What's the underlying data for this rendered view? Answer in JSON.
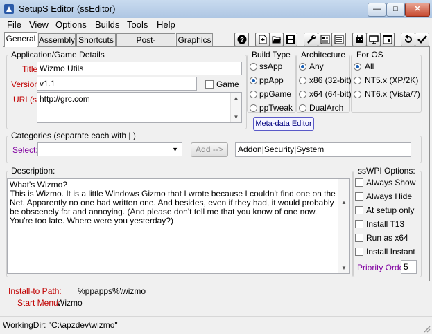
{
  "window": {
    "title": "SetupS Editor (ssEditor)",
    "minimize": "—",
    "maximize": "□",
    "close": "✕"
  },
  "menu": [
    "File",
    "View",
    "Options",
    "Builds",
    "Tools",
    "Help"
  ],
  "tabs": [
    "General",
    "Assembly",
    "Shortcuts",
    "Post-processing",
    "Graphics"
  ],
  "toolbar": [
    "help-icon",
    "new-file-icon",
    "open-folder-icon",
    "save-icon",
    "tools-wrench-icon",
    "properties-icon",
    "list-icon",
    "build-icon",
    "monitor-icon",
    "window-icon",
    "undo-icon",
    "apply-check-icon"
  ],
  "app_details": {
    "legend": "Application/Game Details",
    "title_label": "Title",
    "title_value": "Wizmo Utils",
    "version_label": "Version",
    "version_value": "v1.1",
    "game_label": "Game",
    "urls_label": "URL(s)",
    "urls_value": "http://grc.com"
  },
  "build_type": {
    "legend": "Build Type",
    "options": [
      "ssApp",
      "ppApp",
      "ppGame",
      "ppTweak"
    ],
    "selected": 1
  },
  "architecture": {
    "legend": "Architecture",
    "options": [
      "Any",
      "x86 (32-bit)",
      "x64 (64-bit)",
      "DualArch"
    ],
    "selected": 0
  },
  "for_os": {
    "legend": "For OS",
    "options": [
      "All",
      "NT5.x (XP/2K)",
      "NT6.x (Vista/7)"
    ],
    "selected": 0
  },
  "metadata_button": "Meta-data Editor",
  "categories": {
    "legend": "Categories (separate each with | )",
    "select_label": "Select:",
    "select_value": "",
    "add_button": "Add -->",
    "value": "Addon|Security|System"
  },
  "description": {
    "legend": "Description:",
    "text": "What's Wizmo?\nThis is Wizmo. It is a little Windows Gizmo that I wrote because I couldn't find one on the Net. Apparently no one had written one. And besides, even if they had, it would probably be obscenely fat and annoying. (And please don't tell me that you know of one now. You're too late. Where were you yesterday?)"
  },
  "sswpi": {
    "legend": "ssWPI Options:",
    "options": [
      "Always Show",
      "Always Hide",
      "At setup only",
      "Install T13",
      "Run as x64",
      "Install Instant"
    ],
    "priority_label": "Priority Order",
    "priority_value": "5"
  },
  "install_path": {
    "label": "Install-to Path:",
    "value": "%ppapps%\\wizmo"
  },
  "start_menu": {
    "label": "Start Menu:",
    "value": "Wizmo"
  },
  "status": "WorkingDir: \"C:\\apzdev\\wizmo\""
}
